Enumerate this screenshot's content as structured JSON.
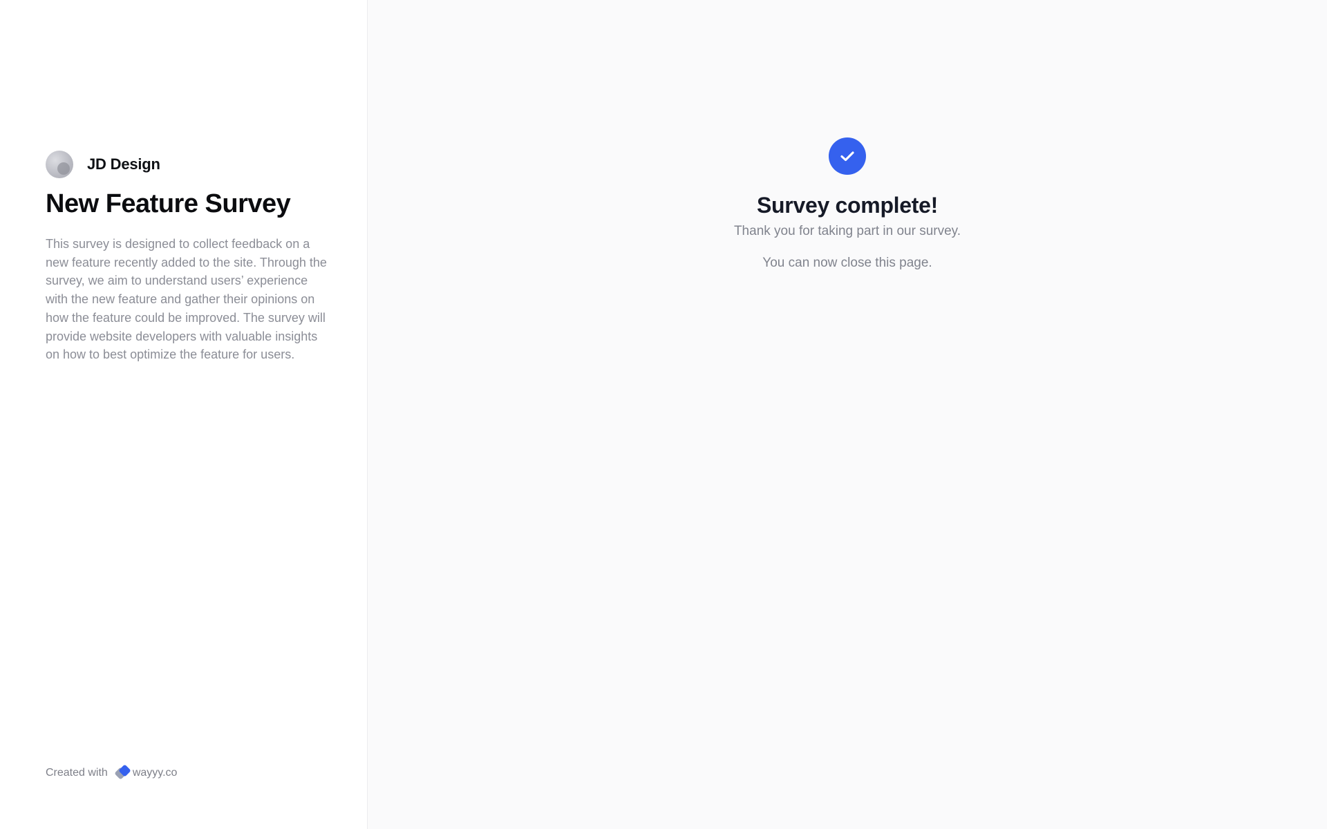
{
  "sidebar": {
    "brand_name": "JD Design",
    "survey_title": "New Feature Survey",
    "survey_description": "This survey is designed to collect feedback on a new feature recently added to the site. Through the survey, we aim to understand users’ experience with the new feature and gather their opinions on how the feature could be improved. The survey will provide website developers with valuable insights on how to best optimize the feature for users.",
    "footer": {
      "created_with": "Created with",
      "link_text": "wayyy.co"
    }
  },
  "main": {
    "icon": "check-icon",
    "title": "Survey complete!",
    "thanks": "Thank you for taking part in our survey.",
    "close_note": "You can now close this page."
  },
  "colors": {
    "accent": "#3561ee",
    "sidebar_bg": "#ffffff",
    "main_bg": "#fafafb",
    "muted_text": "#8b8d96"
  }
}
